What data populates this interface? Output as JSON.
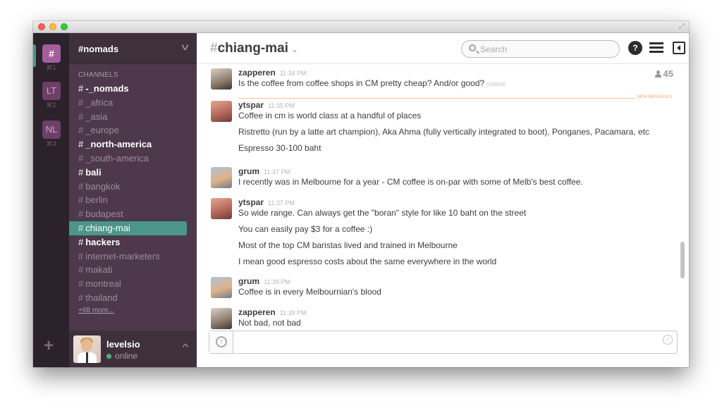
{
  "teams": [
    {
      "label": "#",
      "key": "⌘1"
    },
    {
      "label": "LT",
      "key": "⌘2"
    },
    {
      "label": "NL",
      "key": "⌘3"
    }
  ],
  "add_team_label": "+",
  "sidebar": {
    "team_name": "#nomads",
    "section_title": "CHANNELS",
    "channels": [
      {
        "name": "-_nomads",
        "bold": true
      },
      {
        "name": "_africa"
      },
      {
        "name": "_asia"
      },
      {
        "name": "_europe"
      },
      {
        "name": "_north-america",
        "bold": true
      },
      {
        "name": "_south-america"
      },
      {
        "name": "bali",
        "bold": true
      },
      {
        "name": "bangkok"
      },
      {
        "name": "berlin"
      },
      {
        "name": "budapest"
      },
      {
        "name": "chiang-mai",
        "selected": true
      },
      {
        "name": "hackers",
        "bold": true
      },
      {
        "name": "internet-marketers"
      },
      {
        "name": "makati"
      },
      {
        "name": "montreal"
      },
      {
        "name": "thailand"
      }
    ],
    "more_label": "+68 more...",
    "user": {
      "name": "levelsio",
      "status": "online"
    }
  },
  "header": {
    "hash": "#",
    "channel": "chiang-mai",
    "chevron": "⌄",
    "search_placeholder": "Search",
    "help_label": "?"
  },
  "member_count": "45",
  "new_messages_label": "NEW MESSAGES",
  "messages": [
    {
      "author": "zapperen",
      "time": "11:34 PM",
      "avatar": "zapperen",
      "lines": [
        "Is the coffee from coffee shops in CM pretty cheap? And/or good?"
      ],
      "edited": "(edited)"
    },
    {
      "author": "ytspar",
      "time": "11:35 PM",
      "avatar": "ytspar",
      "lines": [
        "Coffee in cm is world class at a handful of places",
        "Ristretto (run by a latte art champion), Aka Ahma (fully vertically integrated to boot), Ponganes, Pacamara, etc",
        "Espresso 30-100 baht"
      ]
    },
    {
      "author": "grum",
      "time": "11:37 PM",
      "avatar": "grum",
      "lines": [
        "I recently was in Melbourne for a year - CM coffee is on-par with some of Melb's best coffee."
      ]
    },
    {
      "author": "ytspar",
      "time": "11:37 PM",
      "avatar": "ytspar",
      "lines": [
        "So wide range. Can always get the \"boran\" style for like 10 baht on the street",
        "You can easily pay $3 for a coffee :)",
        "Most of the top CM baristas lived and trained in Melbourne",
        "I mean good espresso costs about the same everywhere in the world"
      ]
    },
    {
      "author": "grum",
      "time": "11:39 PM",
      "avatar": "grum",
      "lines": [
        "Coffee is in every Melbournian's blood"
      ]
    },
    {
      "author": "zapperen",
      "time": "11:39 PM",
      "avatar": "zapperen",
      "lines": [
        "Not bad, not bad"
      ]
    }
  ],
  "composer": {
    "value": "",
    "upload_label": "↑",
    "emoji_label": "☺"
  }
}
